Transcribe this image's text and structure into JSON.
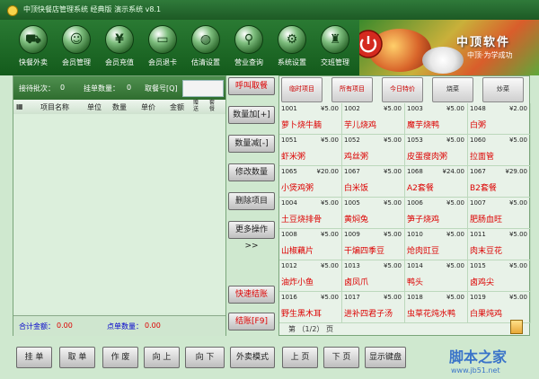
{
  "window": {
    "title": "中顶快餐店管理系统 经典版 演示系统 v8.1"
  },
  "toolbar": [
    {
      "label": "快餐外卖",
      "icon": "motorbike-icon",
      "glyph": "⛟"
    },
    {
      "label": "会员管理",
      "icon": "user-icon",
      "glyph": "☺"
    },
    {
      "label": "会员充值",
      "icon": "recharge-card-icon",
      "glyph": "¥"
    },
    {
      "label": "会员退卡",
      "icon": "card-return-icon",
      "glyph": "▭"
    },
    {
      "label": "估清设置",
      "icon": "plate-icon",
      "glyph": "◍"
    },
    {
      "label": "营业查询",
      "icon": "magnifier-icon",
      "glyph": "⚲"
    },
    {
      "label": "系统设置",
      "icon": "gear-icon",
      "glyph": "⚙"
    },
    {
      "label": "交班管理",
      "icon": "chef-icon",
      "glyph": "♜"
    }
  ],
  "brand": {
    "name": "中顶软件",
    "tagline": "中顶·为学成功"
  },
  "order_info": {
    "batch_label": "接待批次：",
    "batch_value": "0",
    "count_label": "挂单数量：",
    "count_value": "0",
    "order_no_label": "取餐号[Q]"
  },
  "grid": {
    "columns": [
      "项目名称",
      "单位",
      "数量",
      "单价",
      "金额",
      "赠送",
      "套餐"
    ]
  },
  "totals": {
    "amount_label": "合计金额：",
    "amount_value": "0.00",
    "qty_label": "点单数量：",
    "qty_value": "0.00"
  },
  "side_buttons": {
    "call": "呼叫取餐",
    "qty_add": "数量加[+]",
    "qty_sub": "数量减[-]",
    "modify_qty": "修改数量",
    "delete_item": "删除项目",
    "more_ops": "更多操作>>",
    "quick_checkout": "快速结账",
    "checkout": "结账[F9]"
  },
  "menu_tabs": [
    {
      "label": "临时项目",
      "color": "red"
    },
    {
      "label": "所有项目",
      "color": "red"
    },
    {
      "label": "今日特价",
      "color": "red"
    },
    {
      "label": "烧菜",
      "color": "dark"
    },
    {
      "label": "炒菜",
      "color": "dark"
    }
  ],
  "menu_items": [
    {
      "code": "1001",
      "price": "¥5.00",
      "name": "萝卜烧牛腩"
    },
    {
      "code": "1002",
      "price": "¥5.00",
      "name": "芋儿烧鸡"
    },
    {
      "code": "1003",
      "price": "¥5.00",
      "name": "魔芋烧鸭"
    },
    {
      "code": "1048",
      "price": "¥2.00",
      "name": "白粥"
    },
    {
      "code": "1051",
      "price": "¥5.00",
      "name": "虾米粥"
    },
    {
      "code": "1052",
      "price": "¥5.00",
      "name": "鸡丝粥"
    },
    {
      "code": "1053",
      "price": "¥5.00",
      "name": "皮蛋瘦肉粥"
    },
    {
      "code": "1060",
      "price": "¥5.00",
      "name": "拉面管"
    },
    {
      "code": "1065",
      "price": "¥20.00",
      "name": "小煲鸡粥"
    },
    {
      "code": "1067",
      "price": "¥5.00",
      "name": "白米饭"
    },
    {
      "code": "1068",
      "price": "¥24.00",
      "name": "A2套餐"
    },
    {
      "code": "1067",
      "price": "¥29.00",
      "name": "B2套餐"
    },
    {
      "code": "1004",
      "price": "¥5.00",
      "name": "土豆烧排骨"
    },
    {
      "code": "1005",
      "price": "¥5.00",
      "name": "黄焖兔"
    },
    {
      "code": "1006",
      "price": "¥5.00",
      "name": "笋子烧鸡"
    },
    {
      "code": "1007",
      "price": "¥5.00",
      "name": "肥肠血旺"
    },
    {
      "code": "1008",
      "price": "¥5.00",
      "name": "山椒藕片"
    },
    {
      "code": "1009",
      "price": "¥5.00",
      "name": "干煸四季豆"
    },
    {
      "code": "1010",
      "price": "¥5.00",
      "name": "炝肉豇豆"
    },
    {
      "code": "1011",
      "price": "¥5.00",
      "name": "肉末豆花"
    },
    {
      "code": "1012",
      "price": "¥5.00",
      "name": "油炸小鱼"
    },
    {
      "code": "1013",
      "price": "¥5.00",
      "name": "卤凤爪"
    },
    {
      "code": "1014",
      "price": "¥5.00",
      "name": "鸭头"
    },
    {
      "code": "1015",
      "price": "¥5.00",
      "name": "卤鸡尖"
    },
    {
      "code": "1016",
      "price": "¥5.00",
      "name": "野生黑木耳"
    },
    {
      "code": "1017",
      "price": "¥5.00",
      "name": "进补四君子汤"
    },
    {
      "code": "1018",
      "price": "¥5.00",
      "name": "虫草花炖水鸭"
    },
    {
      "code": "1019",
      "price": "¥5.00",
      "name": "白果炖鸡"
    }
  ],
  "pager": {
    "text": "第 （1/2） 页"
  },
  "bottom_buttons": [
    "挂 单",
    "取 单",
    "作 废",
    "向 上",
    "向 下",
    "外卖模式",
    "上 页",
    "下 页",
    "显示键盘"
  ],
  "watermark": {
    "main": "脚本之家",
    "url": "www.jb51.net"
  }
}
